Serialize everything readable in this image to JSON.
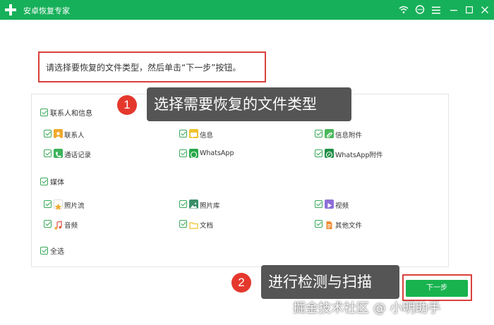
{
  "window": {
    "title": "安卓恢复专家",
    "controls": [
      "wifi-icon",
      "chat-icon",
      "menu-icon",
      "minimize-icon",
      "maximize-icon",
      "close-icon"
    ]
  },
  "instruction": "请选择要恢复的文件类型，然后单击“下一步”按钮。",
  "sections": {
    "contacts": {
      "label": "联系人和信息",
      "items": [
        {
          "label": "联系人",
          "icon": "contact-icon",
          "color": "#f0a92e"
        },
        {
          "label": "信息",
          "icon": "message-icon",
          "color": "#f0c22e"
        },
        {
          "label": "信息附件",
          "icon": "attachment-icon",
          "color": "#4cb85c"
        },
        {
          "label": "通话记录",
          "icon": "phone-icon",
          "color": "#3cb35a"
        },
        {
          "label": "WhatsApp",
          "icon": "whatsapp-icon",
          "color": "#25a84a"
        },
        {
          "label": "WhatsApp附件",
          "icon": "whatsapp-attachment-icon",
          "color": "#1e8f45"
        }
      ]
    },
    "media": {
      "label": "媒体",
      "items": [
        {
          "label": "照片流",
          "icon": "photostream-icon",
          "color": "#f0a92e"
        },
        {
          "label": "照片库",
          "icon": "photo-library-icon",
          "color": "#3a8f6a"
        },
        {
          "label": "视频",
          "icon": "video-icon",
          "color": "#8e6fd8"
        },
        {
          "label": "音频",
          "icon": "audio-icon",
          "color": "#e25b4a"
        },
        {
          "label": "文档",
          "icon": "document-icon",
          "color": "#f0c22e"
        },
        {
          "label": "其他文件",
          "icon": "other-files-icon",
          "color": "#f08a2e"
        }
      ]
    },
    "select_all": {
      "label": "全选"
    }
  },
  "annotations": {
    "step1": {
      "number": "1",
      "text": "选择需要恢复的文件类型"
    },
    "step2": {
      "number": "2",
      "text": "进行检测与扫描"
    }
  },
  "next_button": {
    "label": "下一步"
  },
  "watermark": "掘金技术社区 @ 小明助手",
  "colors": {
    "brand": "#17b05a",
    "highlight": "#d9413c",
    "checkbox": "#3aa85a"
  }
}
